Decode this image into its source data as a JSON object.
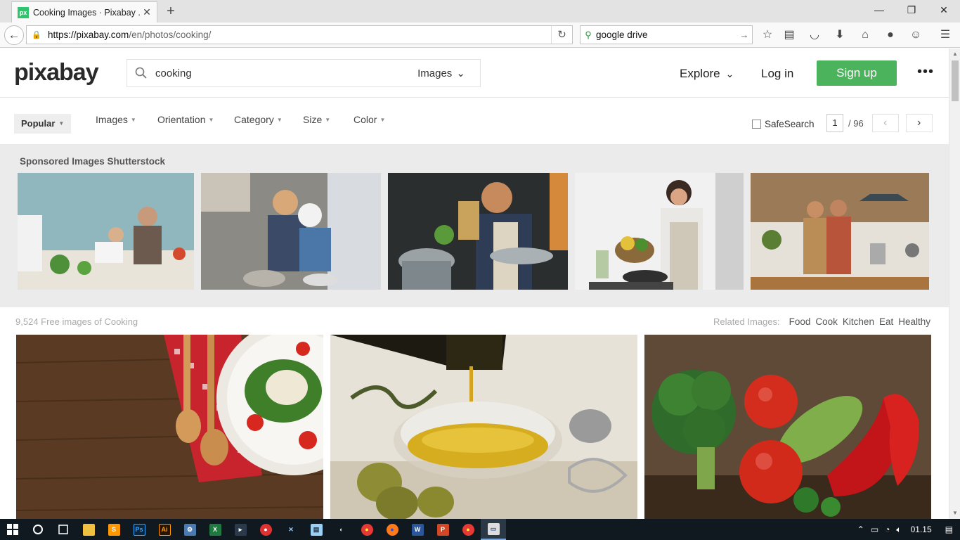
{
  "browser": {
    "tab_title": "Cooking Images · Pixabay ...",
    "tab_favicon": "px",
    "url_host": "https://pixabay.com",
    "url_path": "/en/photos/cooking/",
    "search_value": "google drive"
  },
  "site": {
    "logo": "pixabay",
    "search_query": "cooking",
    "search_type": "Images",
    "nav_explore": "Explore",
    "nav_login": "Log in",
    "nav_signup": "Sign up",
    "more_glyph": "•••",
    "accent_color": "#4bb35c"
  },
  "filters": {
    "popular": "Popular",
    "images": "Images",
    "orientation": "Orientation",
    "category": "Category",
    "size": "Size",
    "color": "Color",
    "safesearch": "SafeSearch",
    "page_current": "1",
    "page_total": "/ 96"
  },
  "sponsored": {
    "title": "Sponsored Images Shutterstock"
  },
  "results": {
    "count_text": "9,524 Free images of Cooking",
    "related_label": "Related Images:",
    "related_tags": [
      "Food",
      "Cook",
      "Kitchen",
      "Eat",
      "Healthy"
    ]
  },
  "taskbar": {
    "clock": "01.15",
    "apps": [
      "start-icon",
      "cortana-icon",
      "task-view-icon",
      "file-explorer-icon",
      "sublime-icon",
      "photoshop-icon",
      "illustrator-icon",
      "app-icon",
      "excel-icon",
      "app-icon-2",
      "app-icon-3",
      "app-icon-4",
      "notepad-icon",
      "app-icon-5",
      "chrome-icon",
      "firefox-icon",
      "word-icon",
      "powerpoint-icon",
      "chrome-icon-2",
      "active-window-icon"
    ]
  }
}
